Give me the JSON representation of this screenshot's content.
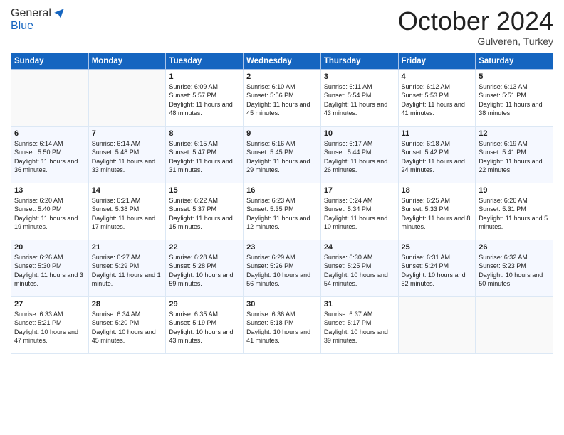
{
  "header": {
    "logo_general": "General",
    "logo_blue": "Blue",
    "month_title": "October 2024",
    "location": "Gulveren, Turkey"
  },
  "calendar": {
    "days_of_week": [
      "Sunday",
      "Monday",
      "Tuesday",
      "Wednesday",
      "Thursday",
      "Friday",
      "Saturday"
    ],
    "weeks": [
      [
        {
          "day": "",
          "info": ""
        },
        {
          "day": "",
          "info": ""
        },
        {
          "day": "1",
          "info": "Sunrise: 6:09 AM\nSunset: 5:57 PM\nDaylight: 11 hours and 48 minutes."
        },
        {
          "day": "2",
          "info": "Sunrise: 6:10 AM\nSunset: 5:56 PM\nDaylight: 11 hours and 45 minutes."
        },
        {
          "day": "3",
          "info": "Sunrise: 6:11 AM\nSunset: 5:54 PM\nDaylight: 11 hours and 43 minutes."
        },
        {
          "day": "4",
          "info": "Sunrise: 6:12 AM\nSunset: 5:53 PM\nDaylight: 11 hours and 41 minutes."
        },
        {
          "day": "5",
          "info": "Sunrise: 6:13 AM\nSunset: 5:51 PM\nDaylight: 11 hours and 38 minutes."
        }
      ],
      [
        {
          "day": "6",
          "info": "Sunrise: 6:14 AM\nSunset: 5:50 PM\nDaylight: 11 hours and 36 minutes."
        },
        {
          "day": "7",
          "info": "Sunrise: 6:14 AM\nSunset: 5:48 PM\nDaylight: 11 hours and 33 minutes."
        },
        {
          "day": "8",
          "info": "Sunrise: 6:15 AM\nSunset: 5:47 PM\nDaylight: 11 hours and 31 minutes."
        },
        {
          "day": "9",
          "info": "Sunrise: 6:16 AM\nSunset: 5:45 PM\nDaylight: 11 hours and 29 minutes."
        },
        {
          "day": "10",
          "info": "Sunrise: 6:17 AM\nSunset: 5:44 PM\nDaylight: 11 hours and 26 minutes."
        },
        {
          "day": "11",
          "info": "Sunrise: 6:18 AM\nSunset: 5:42 PM\nDaylight: 11 hours and 24 minutes."
        },
        {
          "day": "12",
          "info": "Sunrise: 6:19 AM\nSunset: 5:41 PM\nDaylight: 11 hours and 22 minutes."
        }
      ],
      [
        {
          "day": "13",
          "info": "Sunrise: 6:20 AM\nSunset: 5:40 PM\nDaylight: 11 hours and 19 minutes."
        },
        {
          "day": "14",
          "info": "Sunrise: 6:21 AM\nSunset: 5:38 PM\nDaylight: 11 hours and 17 minutes."
        },
        {
          "day": "15",
          "info": "Sunrise: 6:22 AM\nSunset: 5:37 PM\nDaylight: 11 hours and 15 minutes."
        },
        {
          "day": "16",
          "info": "Sunrise: 6:23 AM\nSunset: 5:35 PM\nDaylight: 11 hours and 12 minutes."
        },
        {
          "day": "17",
          "info": "Sunrise: 6:24 AM\nSunset: 5:34 PM\nDaylight: 11 hours and 10 minutes."
        },
        {
          "day": "18",
          "info": "Sunrise: 6:25 AM\nSunset: 5:33 PM\nDaylight: 11 hours and 8 minutes."
        },
        {
          "day": "19",
          "info": "Sunrise: 6:26 AM\nSunset: 5:31 PM\nDaylight: 11 hours and 5 minutes."
        }
      ],
      [
        {
          "day": "20",
          "info": "Sunrise: 6:26 AM\nSunset: 5:30 PM\nDaylight: 11 hours and 3 minutes."
        },
        {
          "day": "21",
          "info": "Sunrise: 6:27 AM\nSunset: 5:29 PM\nDaylight: 11 hours and 1 minute."
        },
        {
          "day": "22",
          "info": "Sunrise: 6:28 AM\nSunset: 5:28 PM\nDaylight: 10 hours and 59 minutes."
        },
        {
          "day": "23",
          "info": "Sunrise: 6:29 AM\nSunset: 5:26 PM\nDaylight: 10 hours and 56 minutes."
        },
        {
          "day": "24",
          "info": "Sunrise: 6:30 AM\nSunset: 5:25 PM\nDaylight: 10 hours and 54 minutes."
        },
        {
          "day": "25",
          "info": "Sunrise: 6:31 AM\nSunset: 5:24 PM\nDaylight: 10 hours and 52 minutes."
        },
        {
          "day": "26",
          "info": "Sunrise: 6:32 AM\nSunset: 5:23 PM\nDaylight: 10 hours and 50 minutes."
        }
      ],
      [
        {
          "day": "27",
          "info": "Sunrise: 6:33 AM\nSunset: 5:21 PM\nDaylight: 10 hours and 47 minutes."
        },
        {
          "day": "28",
          "info": "Sunrise: 6:34 AM\nSunset: 5:20 PM\nDaylight: 10 hours and 45 minutes."
        },
        {
          "day": "29",
          "info": "Sunrise: 6:35 AM\nSunset: 5:19 PM\nDaylight: 10 hours and 43 minutes."
        },
        {
          "day": "30",
          "info": "Sunrise: 6:36 AM\nSunset: 5:18 PM\nDaylight: 10 hours and 41 minutes."
        },
        {
          "day": "31",
          "info": "Sunrise: 6:37 AM\nSunset: 5:17 PM\nDaylight: 10 hours and 39 minutes."
        },
        {
          "day": "",
          "info": ""
        },
        {
          "day": "",
          "info": ""
        }
      ]
    ]
  }
}
